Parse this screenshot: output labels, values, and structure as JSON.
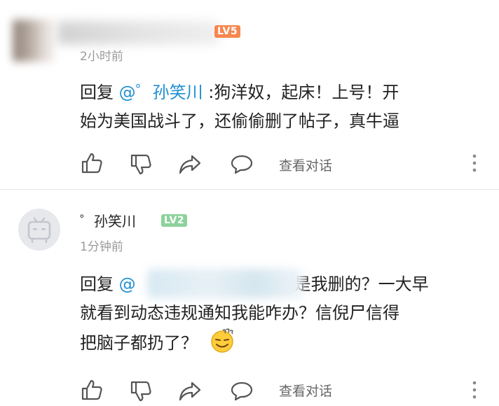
{
  "comment1": {
    "level_badge": "LV5",
    "time": "2小时前",
    "reply_prefix": "回复 ",
    "mention": "@゜孙笑川",
    "line1_rest": " :狗洋奴，起床！上号！开",
    "line2": "始为美国战斗了，还偷偷删了帖子，真牛逼",
    "view_conversation": "查看对话"
  },
  "comment2": {
    "username": "゜孙笑川",
    "level_badge": "LV2",
    "time": "1分钟前",
    "reply_prefix": "回复 ",
    "mention_visible": "@",
    "line1_rest": "是我删的？一大早",
    "line2": "就看到动态违规通知我能咋办？信倪尸信得",
    "line3": "把脑子都扔了？",
    "view_conversation": "查看对话"
  },
  "colors": {
    "lv5_badge": "#f6874f",
    "lv2_badge": "#8bd29b",
    "mention": "#1f8fd1",
    "icon": "#555555",
    "time": "#9a9a9a",
    "divider": "#e7e7e7"
  },
  "icons": [
    "like-icon",
    "dislike-icon",
    "share-icon",
    "comment-icon",
    "more-icon",
    "emoji-icon"
  ]
}
